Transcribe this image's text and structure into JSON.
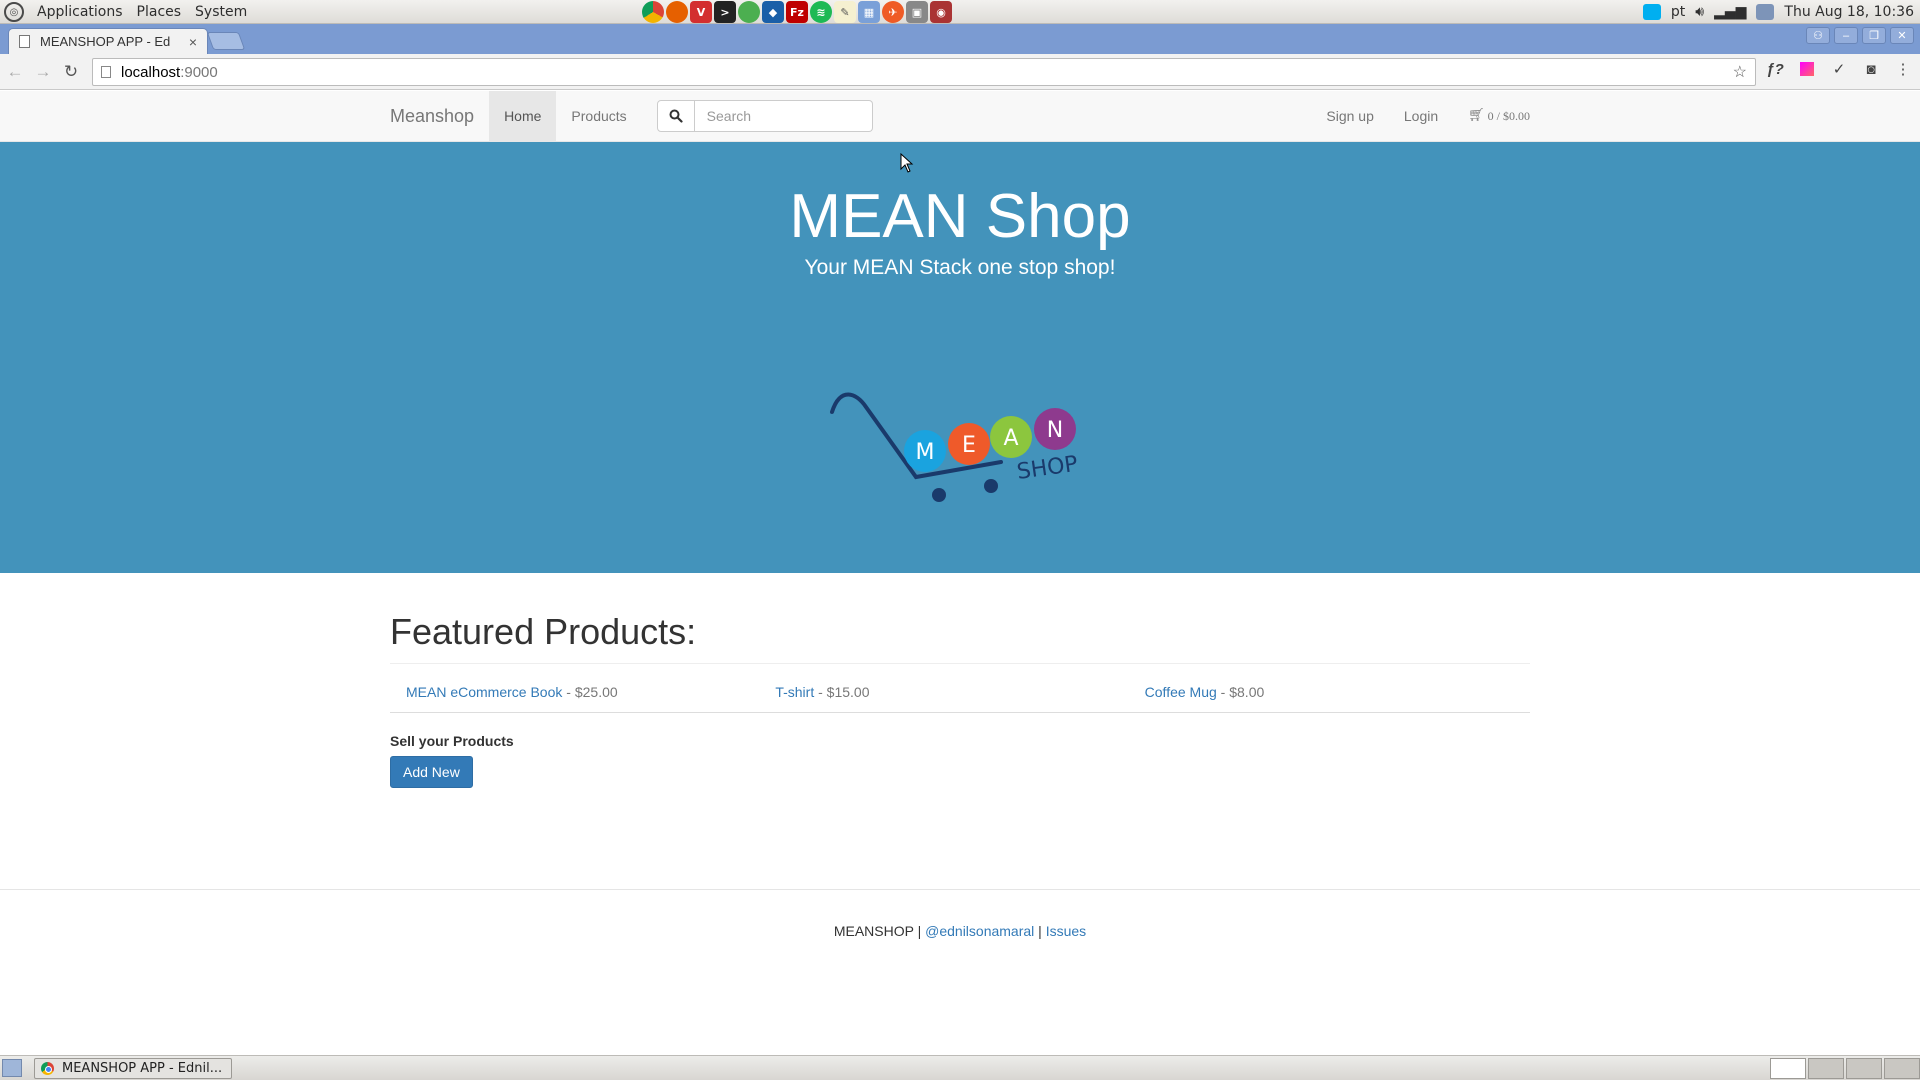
{
  "top_panel": {
    "menus": [
      "Applications",
      "Places",
      "System"
    ],
    "launchers": [
      "chrome-icon",
      "firefox-icon",
      "vivaldi-icon",
      "terminal-icon",
      "globe-icon",
      "virtualbox-icon",
      "filezilla-icon",
      "spotify-icon",
      "text-editor-icon",
      "calendar-icon",
      "postman-icon",
      "system-monitor-icon",
      "screenshot-icon"
    ],
    "keyboard_layout": "pt",
    "clock": "Thu Aug 18, 10:36"
  },
  "browser": {
    "tab_title": "MEANSHOP APP - Ed",
    "tab_close": "×",
    "url_host": "localhost",
    "url_port": ":9000",
    "star": "☆",
    "ext_fx": "ƒ?"
  },
  "navbar": {
    "brand": "Meanshop",
    "home": "Home",
    "products": "Products",
    "search_placeholder": "Search",
    "signup": "Sign up",
    "login": "Login",
    "cart_count": "0",
    "cart_sep": " / ",
    "cart_total": "$0.00"
  },
  "hero": {
    "title": "MEAN Shop",
    "subtitle": "Your MEAN Stack one stop shop!",
    "logo_letters": [
      "M",
      "E",
      "A",
      "N"
    ],
    "logo_word": "SHOP",
    "colors": {
      "background": "#4393bb",
      "m": "#1aa3df",
      "e": "#ef5a2a",
      "a": "#8cc63e",
      "n": "#8e3a8e",
      "cart": "#1a3a6b"
    }
  },
  "featured": {
    "heading": "Featured Products:",
    "products": [
      {
        "name": "MEAN eCommerce Book",
        "price": "$25.00"
      },
      {
        "name": "T-shirt",
        "price": "$15.00"
      },
      {
        "name": "Coffee Mug",
        "price": "$8.00"
      }
    ],
    "separator": " - ",
    "sell_label": "Sell your Products",
    "add_button": "Add New"
  },
  "footer": {
    "brand": "MEANSHOP",
    "divider": " | ",
    "twitter": "@ednilsonamaral",
    "issues": "Issues"
  },
  "taskbar": {
    "task_label": "MEANSHOP APP - Ednil..."
  },
  "colors": {
    "accent": "#337ab7",
    "navbar_bg": "#f8f8f8",
    "tabstrip": "#7b9bd2"
  }
}
